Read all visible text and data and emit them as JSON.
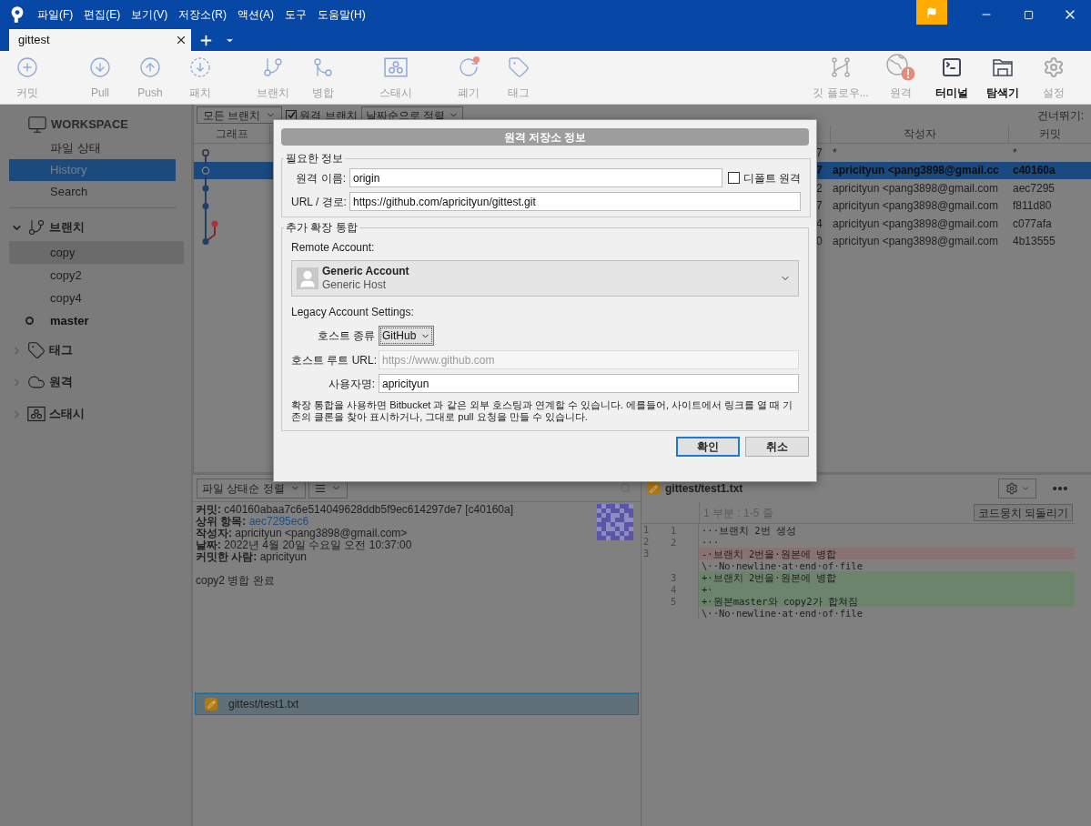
{
  "window": {
    "menu": [
      "파일(F)",
      "편집(E)",
      "보기(V)",
      "저장소(R)",
      "액션(A)",
      "도구",
      "도움말(H)"
    ],
    "tabs": [
      {
        "label": "gittest",
        "selected": true
      }
    ]
  },
  "toolbar": {
    "left": [
      {
        "label": "커밋",
        "disabled": true
      },
      {
        "label": "Pull",
        "disabled": true
      },
      {
        "label": "Push",
        "disabled": true
      },
      {
        "label": "패치",
        "disabled": true
      },
      {
        "label": "브랜치",
        "disabled": true
      },
      {
        "label": "병합",
        "disabled": true
      },
      {
        "label": "스태시",
        "disabled": true
      },
      {
        "label": "폐기",
        "disabled": true
      },
      {
        "label": "태그",
        "disabled": true
      }
    ],
    "right": [
      {
        "label": "깃 플로우...",
        "disabled": true
      },
      {
        "label": "원격",
        "disabled": true
      },
      {
        "label": "터미널",
        "disabled": false
      },
      {
        "label": "탐색기",
        "disabled": false
      },
      {
        "label": "설정",
        "disabled": true
      }
    ]
  },
  "sidebar": {
    "workspace": {
      "title": "WORKSPACE",
      "items": [
        {
          "label": "파일 상태",
          "selected": false
        },
        {
          "label": "History",
          "selected": true
        },
        {
          "label": "Search",
          "selected": false
        }
      ]
    },
    "sections": [
      {
        "label": "브랜치",
        "expanded": true,
        "items": [
          {
            "label": "copy",
            "selected": true,
            "current": false
          },
          {
            "label": "copy2",
            "selected": false,
            "current": false
          },
          {
            "label": "copy4",
            "selected": false,
            "current": false
          },
          {
            "label": "master",
            "selected": false,
            "current": true
          }
        ]
      },
      {
        "label": "태그",
        "expanded": false
      },
      {
        "label": "원격",
        "expanded": false
      },
      {
        "label": "스태시",
        "expanded": false
      }
    ]
  },
  "filter_bar": {
    "branches": "모든 브랜치",
    "remote_branches": {
      "label": "원격 브랜치",
      "checked": true
    },
    "sort": "날짜순으로 정렬",
    "skip_label": "건너뛰기:"
  },
  "history": {
    "columns": [
      "그래프",
      "작성자",
      "커밋"
    ],
    "rows": [
      {
        "column_3": "7",
        "author": "*",
        "commit": "*",
        "selected": false
      },
      {
        "column_3": "7",
        "author": "apricityun <pang3898@gmail.cc",
        "commit": "c40160a",
        "selected": true
      },
      {
        "column_3": "2",
        "author": "apricityun <pang3898@gmail.com",
        "commit": "aec7295",
        "selected": false
      },
      {
        "column_3": "7",
        "author": "apricityun <pang3898@gmail.com",
        "commit": "f811d80",
        "selected": false
      },
      {
        "column_3": "4",
        "author": "apricityun <pang3898@gmail.com",
        "commit": "c077afa",
        "selected": false
      },
      {
        "column_3": "0",
        "author": "apricityun <pang3898@gmail.com",
        "commit": "4b13555",
        "selected": false
      }
    ]
  },
  "details": {
    "sort": "파일 상태순 정렬",
    "lines": [
      {
        "label": "커밋:",
        "value": "c40160abaa7c6e514049628ddb5f9ec614297de7 [c40160a]",
        "link": false
      },
      {
        "label": "상위 항목:",
        "value": "aec7295ec6",
        "link": true
      },
      {
        "label": "작성자:",
        "value": "apricityun <pang3898@gmail.com>",
        "link": false
      },
      {
        "label": "날짜:",
        "value": "2022년 4월 20일 수요일 오전 10:37:00",
        "link": false
      },
      {
        "label": "커밋한 사람:",
        "value": "apricityun",
        "link": false
      }
    ],
    "message": "copy2 병합 완료",
    "files": [
      {
        "name": "gittest/test1.txt",
        "selected": true
      }
    ]
  },
  "diff": {
    "file": "gittest/test1.txt",
    "hunk": "1 부분 : 1-5 줄",
    "revert": "코드뭉치 되돌리기",
    "lines": [
      {
        "old": "1",
        "new": "1",
        "text": "···브랜치 2번 생성",
        "kind": "context"
      },
      {
        "old": "2",
        "new": "2",
        "text": "···",
        "kind": "context"
      },
      {
        "old": "3",
        "text": "-·브랜치 2번을·원본에 병합",
        "kind": "removed"
      },
      {
        "text": "\\··No·newline·at·end·of·file",
        "kind": "context"
      },
      {
        "new": "3",
        "text": "+·브랜치 2번을·원본에 병합",
        "kind": "added"
      },
      {
        "new": "4",
        "text": "+·",
        "kind": "added"
      },
      {
        "new": "5",
        "text": "+·원본master와 copy2가 합쳐짐",
        "kind": "added"
      },
      {
        "text": "\\··No·newline·at·end·of·file",
        "kind": "context"
      }
    ]
  },
  "dialog": {
    "title": "원격 저장소 정보",
    "required": {
      "legend": "필요한 정보",
      "name": {
        "label": "원격 이름:",
        "value": "origin"
      },
      "default_remote": {
        "label": "디폴트 원격",
        "checked": false
      },
      "url": {
        "label": "URL / 경로:",
        "value": "https://github.com/apricityun/gittest.git"
      }
    },
    "integration": {
      "legend": "추가 확장 통합",
      "remote_account_label": "Remote Account:",
      "account": {
        "name": "Generic Account",
        "host": "Generic Host"
      },
      "legacy_label": "Legacy Account Settings:",
      "host_type": {
        "label": "호스트 종류",
        "value": "GitHub"
      },
      "host_root_url": {
        "label": "호스트 루트 URL:",
        "value": "https://www.github.com",
        "disabled": true
      },
      "username": {
        "label": "사용자명:",
        "value": "apricityun",
        "disabled": false
      },
      "description": "확장 통합을 사용하면 Bitbucket 과 같은 외부 호스팅과 연계할 수 있습니다. 에를들어, 사이트에서 링크를 열 때 기존의 클론을 찾아 표시하거나, 그대로 pull 요청을 만들 수 있습니다."
    },
    "buttons": [
      {
        "label": "확인",
        "default": true
      },
      {
        "label": "취소",
        "default": false
      }
    ]
  }
}
